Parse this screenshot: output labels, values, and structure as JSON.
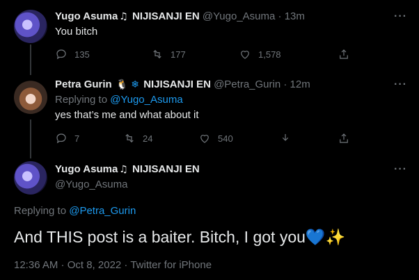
{
  "tweet1": {
    "name": "Yugo Asuma",
    "badge1_icon": "music-note-icon",
    "affiliation": "NIJISANJI EN",
    "handle": "@Yugo_Asuma",
    "time": "· 13m",
    "text": "You bitch",
    "replies": "135",
    "retweets": "177",
    "likes": "1,578"
  },
  "tweet2": {
    "name": "Petra Gurin",
    "badge1_icon": "penguin-icon",
    "badge2_icon": "snowflake-icon",
    "affiliation": "NIJISANJI EN",
    "handle": "@Petra_Gurin",
    "time": "· 12m",
    "replying_prefix": "Replying to",
    "replying_to": "@Yugo_Asuma",
    "text": "yes that’s me and what about it",
    "replies": "7",
    "retweets": "24",
    "likes": "540"
  },
  "main": {
    "name": "Yugo Asuma",
    "badge1_icon": "music-note-icon",
    "affiliation": "NIJISANJI EN",
    "handle": "@Yugo_Asuma",
    "replying_prefix": "Replying to",
    "replying_to": "@Petra_Gurin",
    "text": "And THIS post is a baiter. Bitch, I got you",
    "meta": "12:36 AM · Oct 8, 2022 · Twitter for iPhone"
  },
  "colors": {
    "accent": "#1d9bf0",
    "muted": "#71767b",
    "background": "#000000"
  }
}
